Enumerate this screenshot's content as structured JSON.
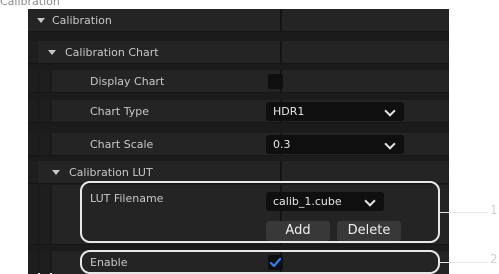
{
  "page_title": "Calibration",
  "sections": {
    "calibration": "Calibration",
    "calibration_chart": "Calibration Chart",
    "calibration_lut": "Calibration LUT"
  },
  "properties": {
    "display_chart": "Display Chart",
    "chart_type": "Chart Type",
    "chart_type_value": "HDR1",
    "chart_scale": "Chart Scale",
    "chart_scale_value": "0.3",
    "lut_filename": "LUT Filename",
    "lut_filename_value": "calib_1.cube",
    "enable": "Enable"
  },
  "buttons": {
    "add": "Add",
    "delete": "Delete"
  },
  "display_chart_checked": false,
  "enable_checked": true,
  "callouts": [
    "1",
    "2"
  ],
  "colors": {
    "panel_bg": "#242424",
    "field_bg": "#0f0f0f",
    "check_accent": "#2f7ff0",
    "button_bg": "#383838"
  }
}
